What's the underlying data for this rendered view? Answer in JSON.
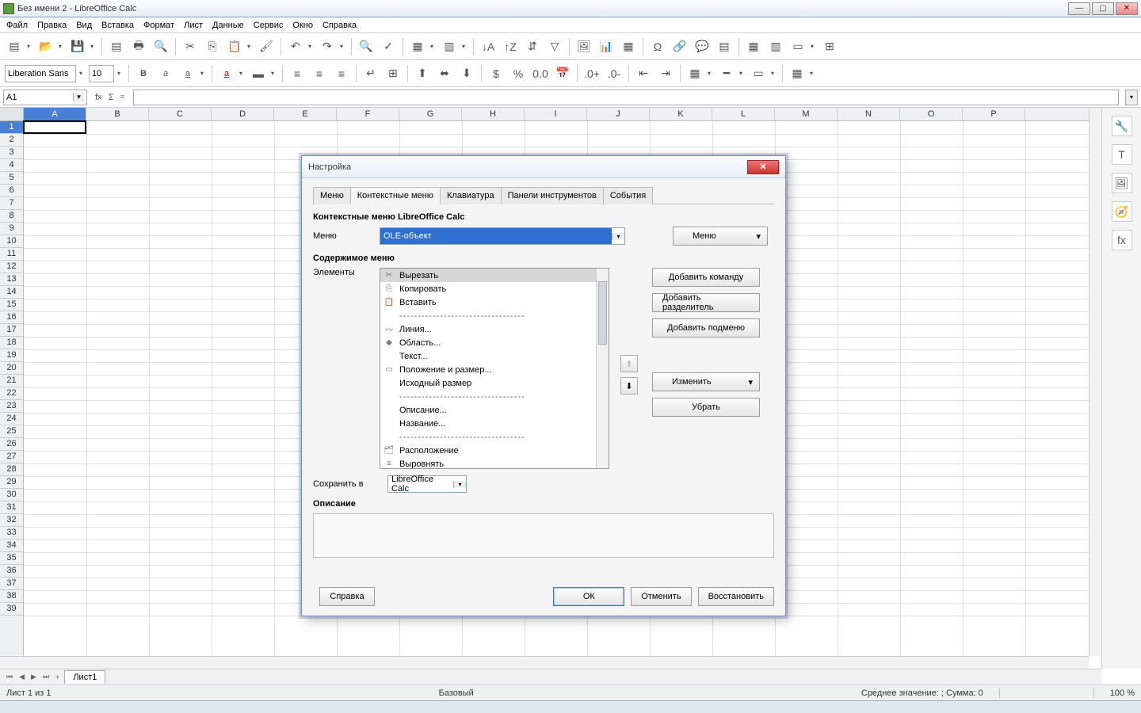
{
  "window": {
    "title": "Без имени 2 - LibreOffice Calc"
  },
  "menu": [
    "Файл",
    "Правка",
    "Вид",
    "Вставка",
    "Формат",
    "Лист",
    "Данные",
    "Сервис",
    "Окно",
    "Справка"
  ],
  "format": {
    "font": "Liberation Sans",
    "size": "10"
  },
  "namebox": "A1",
  "columns": [
    "A",
    "B",
    "C",
    "D",
    "E",
    "F",
    "G",
    "H",
    "I",
    "J",
    "K",
    "L",
    "M",
    "N",
    "O",
    "P"
  ],
  "rows_count": 39,
  "sheet_tab": "Лист1",
  "status": {
    "sheet": "Лист 1 из 1",
    "mode": "Базовый",
    "summary": "Среднее значение: ; Сумма: 0",
    "zoom": "100 %"
  },
  "dialog": {
    "title": "Настройка",
    "tabs": [
      "Меню",
      "Контекстные меню",
      "Клавиатура",
      "Панели инструментов",
      "События"
    ],
    "active_tab": 1,
    "heading": "Контекстные меню LibreOffice Calc",
    "menu_label": "Меню",
    "menu_value": "OLE-объект",
    "menu_button": "Меню",
    "content_label": "Содержимое меню",
    "elements_label": "Элементы",
    "items": [
      {
        "icon": "✂",
        "text": "Вырезать",
        "sel": true
      },
      {
        "icon": "⎘",
        "text": "Копировать"
      },
      {
        "icon": "📋",
        "text": "Вставить"
      },
      {
        "sep": true
      },
      {
        "icon": "〰",
        "text": "Линия..."
      },
      {
        "icon": "◆",
        "text": "Область..."
      },
      {
        "icon": "",
        "text": "Текст..."
      },
      {
        "icon": "▭",
        "text": "Положение и размер..."
      },
      {
        "icon": "",
        "text": "Исходный размер"
      },
      {
        "sep": true
      },
      {
        "icon": "",
        "text": "Описание..."
      },
      {
        "icon": "",
        "text": "Название..."
      },
      {
        "sep": true
      },
      {
        "icon": "🗂",
        "text": "Расположение",
        "sub": true
      },
      {
        "icon": "≡",
        "text": "Выровнять",
        "sub": true
      }
    ],
    "side_buttons": [
      "Добавить команду",
      "Добавить разделитель",
      "Добавить подменю"
    ],
    "modify": "Изменить",
    "remove": "Убрать",
    "save_in_label": "Сохранить в",
    "save_in_value": "LibreOffice Calc",
    "desc_label": "Описание",
    "footer": {
      "help": "Справка",
      "ok": "ОК",
      "cancel": "Отменить",
      "reset": "Восстановить"
    }
  }
}
